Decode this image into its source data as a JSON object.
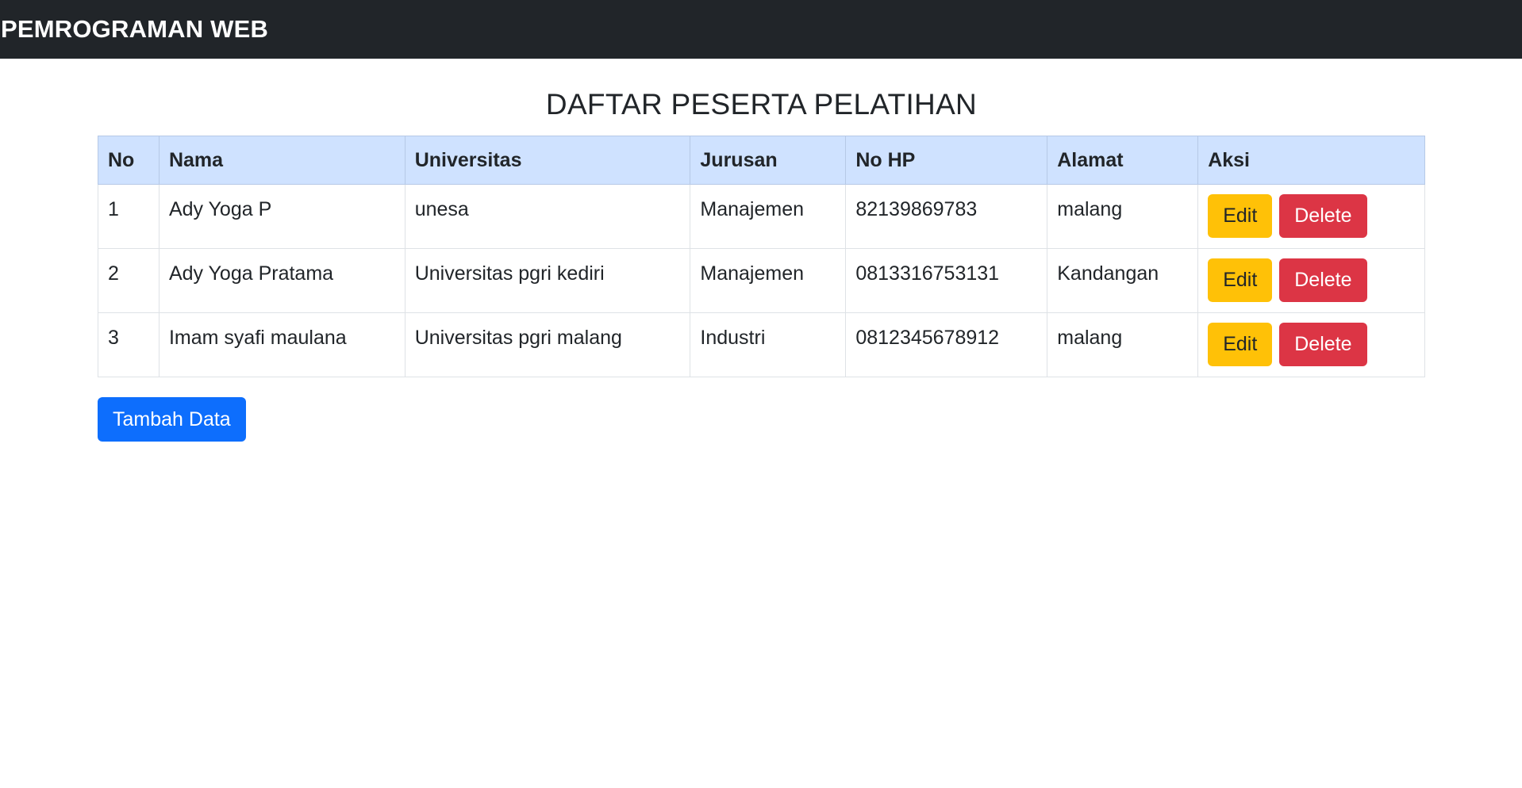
{
  "navbar": {
    "brand": "PEMROGRAMAN WEB"
  },
  "main": {
    "title": "DAFTAR PESERTA PELATIHAN",
    "table": {
      "headers": [
        "No",
        "Nama",
        "Universitas",
        "Jurusan",
        "No HP",
        "Alamat",
        "Aksi"
      ],
      "rows": [
        {
          "no": "1",
          "nama": "Ady Yoga P",
          "universitas": "unesa",
          "jurusan": "Manajemen",
          "no_hp": "82139869783",
          "alamat": "malang"
        },
        {
          "no": "2",
          "nama": "Ady Yoga Pratama",
          "universitas": "Universitas pgri kediri",
          "jurusan": "Manajemen",
          "no_hp": "0813316753131",
          "alamat": "Kandangan"
        },
        {
          "no": "3",
          "nama": "Imam syafi maulana",
          "universitas": "Universitas pgri malang",
          "jurusan": "Industri",
          "no_hp": "0812345678912",
          "alamat": "malang"
        }
      ],
      "edit_label": "Edit",
      "delete_label": "Delete"
    },
    "add_button_label": "Tambah Data"
  },
  "colors": {
    "navbar_bg": "#212529",
    "table_header_bg": "#cfe2ff",
    "edit_button": "#ffc107",
    "delete_button": "#dc3545",
    "add_button": "#0d6efd"
  }
}
